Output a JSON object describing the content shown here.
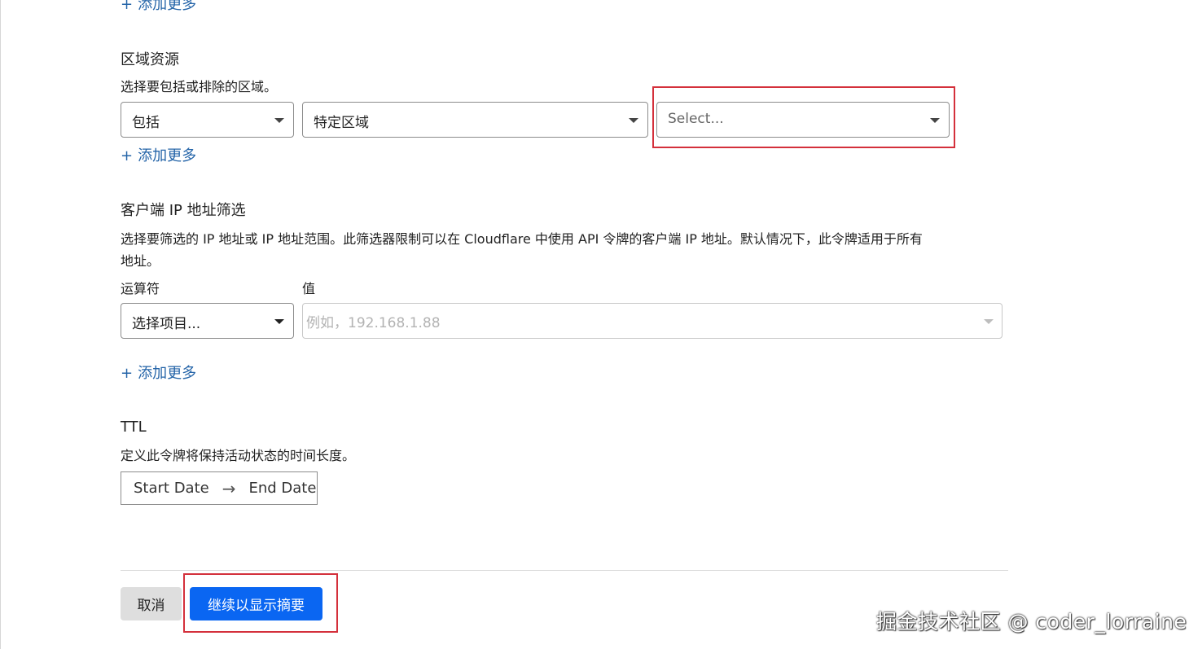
{
  "add_more_top": {
    "plus": "+",
    "label": "添加更多"
  },
  "zone_resources": {
    "title": "区域资源",
    "description": "选择要包括或排除的区域。",
    "include_select": {
      "value": "包括"
    },
    "scope_select": {
      "value": "特定区域"
    },
    "zone_select": {
      "placeholder": "Select..."
    },
    "add_more": {
      "plus": "+",
      "label": "添加更多"
    }
  },
  "client_ip_filter": {
    "title": "客户端 IP 地址筛选",
    "description_line1": "选择要筛选的 IP 地址或 IP 地址范围。此筛选器限制可以在 Cloudflare 中使用 API 令牌的客户端 IP 地址。默认情况下，此令牌适用于所有",
    "description_line2": "地址。",
    "operator_label": "运算符",
    "value_label": "值",
    "operator_select": {
      "value": "选择项目..."
    },
    "value_input": {
      "placeholder": "例如，192.168.1.88"
    },
    "add_more": {
      "plus": "+",
      "label": "添加更多"
    }
  },
  "ttl": {
    "title": "TTL",
    "description": "定义此令牌将保持活动状态的时间长度。",
    "start_date": "Start Date",
    "arrow": "→",
    "end_date": "End Date"
  },
  "footer": {
    "cancel_label": "取消",
    "continue_label": "继续以显示摘要"
  },
  "watermark": "掘金技术社区 @ coder_lorraine",
  "colors": {
    "link": "#2464a8",
    "primary": "#0a66f2",
    "highlight": "#d4303b"
  }
}
